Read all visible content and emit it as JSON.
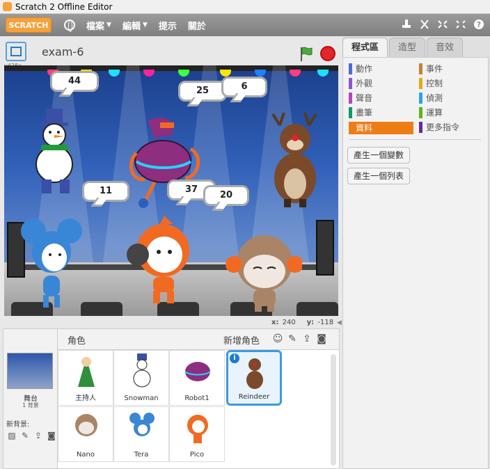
{
  "window": {
    "title": "Scratch 2 Offline Editor"
  },
  "menubar": {
    "logo": "SCRATCH",
    "menus": [
      {
        "label": "檔案",
        "has_caret": true
      },
      {
        "label": "編輯",
        "has_caret": true
      },
      {
        "label": "提示",
        "has_caret": false
      },
      {
        "label": "關於",
        "has_caret": false
      }
    ],
    "caret": "▼"
  },
  "stage_header": {
    "project_name": "exam-6",
    "version": "v428a"
  },
  "stage": {
    "bubbles": [
      "44",
      "25",
      "6",
      "11",
      "37",
      "20"
    ]
  },
  "mouse_readout": {
    "x_label": "x:",
    "x": "240",
    "y_label": "y:",
    "y": "-118"
  },
  "sprites_panel": {
    "title": "角色",
    "new_sprite": "新增角色",
    "stage_label": "舞台",
    "stage_backdrops": "1 背景",
    "new_backdrop": "新背景:",
    "sprites": [
      {
        "name": "主持人",
        "color": "#2f8f3a"
      },
      {
        "name": "Snowman",
        "color": "#ffffff"
      },
      {
        "name": "Robot1",
        "color": "#8e2e7e"
      },
      {
        "name": "Reindeer",
        "color": "#7a4a2a",
        "selected": true
      },
      {
        "name": "Nano",
        "color": "#a98466"
      },
      {
        "name": "Tera",
        "color": "#3a86d6"
      },
      {
        "name": "Pico",
        "color": "#f26a22"
      }
    ],
    "info_icon": "i"
  },
  "code_panel": {
    "tabs": [
      "程式區",
      "造型",
      "音效"
    ],
    "active_tab": 0,
    "categories": [
      {
        "label": "動作",
        "color": "#4a6cd4"
      },
      {
        "label": "事件",
        "color": "#c88330"
      },
      {
        "label": "外觀",
        "color": "#8a55d7"
      },
      {
        "label": "控制",
        "color": "#e1a91a"
      },
      {
        "label": "聲音",
        "color": "#bb42c3"
      },
      {
        "label": "偵測",
        "color": "#2ca5e2"
      },
      {
        "label": "畫筆",
        "color": "#0e9a6c"
      },
      {
        "label": "運算",
        "color": "#5cb712"
      },
      {
        "label": "資料",
        "color": "#ee7d16",
        "selected": true
      },
      {
        "label": "更多指令",
        "color": "#632d99"
      }
    ],
    "buttons": [
      "產生一個變數",
      "產生一個列表"
    ]
  },
  "colors": {
    "accent": "#ee7d16",
    "selection": "#3b9ae0",
    "menubar": "#8c8c8c"
  }
}
